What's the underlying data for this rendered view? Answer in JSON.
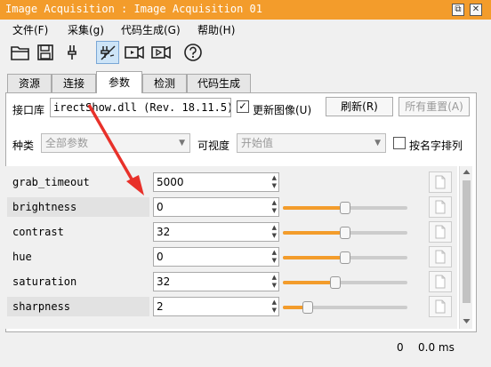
{
  "window": {
    "title": "Image Acquisition : Image Acquisition 01",
    "restore_glyph": "⧉",
    "close_glyph": "✕"
  },
  "menu": [
    "文件(F)",
    "采集(g)",
    "代码生成(G)",
    "帮助(H)"
  ],
  "tabs": [
    "资源",
    "连接",
    "参数",
    "检测",
    "代码生成"
  ],
  "active_tab": "参数",
  "interface": {
    "label": "接口库",
    "value": "irectShow.dll (Rev. 18.11.5)",
    "update_checkbox_label": "更新图像(U)",
    "update_checked_glyph": "✓",
    "refresh_label": "刷新(R)",
    "reset_all_label": "所有重置(A)"
  },
  "filters": {
    "category_label": "种类",
    "category_value": "全部参数",
    "visibility_label": "可视度",
    "visibility_value": "开始值",
    "sort_checkbox_label": "按名字排列",
    "combo_arrow": "▼"
  },
  "parameters": [
    {
      "name": "grab_timeout",
      "value": "5000",
      "level": null
    },
    {
      "name": "brightness",
      "value": "0",
      "level": 0.5
    },
    {
      "name": "contrast",
      "value": "32",
      "level": 0.5
    },
    {
      "name": "hue",
      "value": "0",
      "level": 0.5
    },
    {
      "name": "saturation",
      "value": "32",
      "level": 0.42
    },
    {
      "name": "sharpness",
      "value": "2",
      "level": 0.2
    }
  ],
  "status": {
    "count": "0",
    "time": "0.0 ms"
  },
  "colors": {
    "title_bar": "#f39c2b",
    "annotation_arrow": "#e8312a"
  }
}
